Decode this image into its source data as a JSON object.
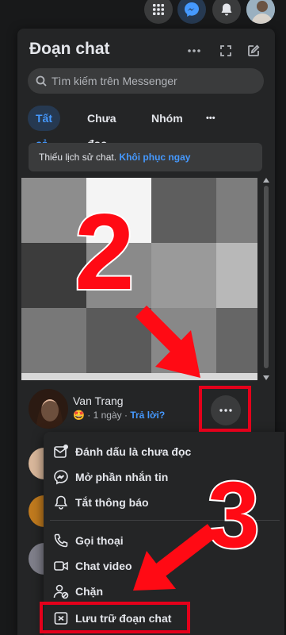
{
  "topbar": {
    "icons": [
      "menu-grid-icon",
      "messenger-icon",
      "bell-icon",
      "profile-avatar"
    ],
    "colors": {
      "messenger_active": "#4599ff"
    }
  },
  "panel": {
    "title": "Đoạn chat",
    "header_icons": [
      "more-icon",
      "expand-icon",
      "compose-icon"
    ],
    "search_placeholder": "Tìm kiếm trên Messenger",
    "tabs": [
      {
        "label": "Tất cả",
        "active": true
      },
      {
        "label": "Chưa đọc",
        "active": false
      },
      {
        "label": "Nhóm",
        "active": false
      },
      {
        "label": "•••",
        "active": false
      }
    ],
    "banner": {
      "text": "Thiếu lịch sử chat.",
      "link": "Khôi phục ngay"
    }
  },
  "chat": {
    "name": "Van Trang",
    "emoji": "🤩",
    "time": "· 1 ngày ·",
    "reply": "Trả lời?"
  },
  "menu": {
    "items": [
      {
        "label": "Đánh dấu là chưa đọc",
        "icon": "mark-unread-icon"
      },
      {
        "label": "Mở phần nhắn tin",
        "icon": "messenger-outline-icon"
      },
      {
        "label": "Tắt thông báo",
        "icon": "bell-outline-icon"
      },
      {
        "label": "Gọi thoại",
        "icon": "phone-icon"
      },
      {
        "label": "Chat video",
        "icon": "video-camera-icon"
      },
      {
        "label": "Chặn",
        "icon": "block-user-icon"
      },
      {
        "label": "Lưu trữ đoạn chat",
        "icon": "archive-icon"
      }
    ]
  },
  "annotations": {
    "step2": "2",
    "step3": "3",
    "color": "#ff0a14"
  }
}
